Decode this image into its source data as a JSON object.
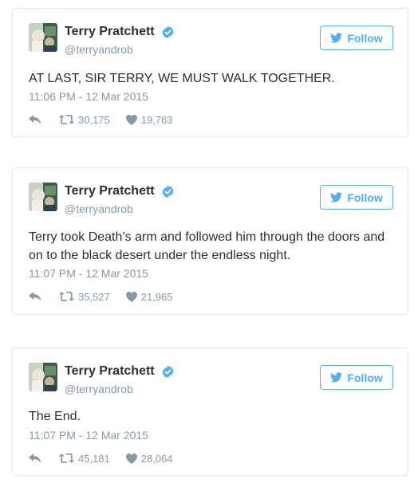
{
  "colors": {
    "accent": "#55acee",
    "text": "#292f33",
    "muted": "#8899a6",
    "border": "#e1e8ed"
  },
  "icons": {
    "reply": "reply-icon",
    "retweet": "retweet-icon",
    "like": "heart-icon",
    "verified": "verified-badge-icon",
    "twitter": "twitter-bird-icon"
  },
  "tweets": [
    {
      "author_name": "Terry Pratchett",
      "handle": "@terryandrob",
      "follow_label": "Follow",
      "text": "AT LAST, SIR TERRY, WE MUST WALK TOGETHER.",
      "timestamp": "11:06 PM - 12 Mar 2015",
      "retweets": "30,175",
      "likes": "19,763"
    },
    {
      "author_name": "Terry Pratchett",
      "handle": "@terryandrob",
      "follow_label": "Follow",
      "text": "Terry took Death’s arm and followed him through the doors and on to the black desert under the endless night.",
      "timestamp": "11:07 PM - 12 Mar 2015",
      "retweets": "35,527",
      "likes": "21,965"
    },
    {
      "author_name": "Terry Pratchett",
      "handle": "@terryandrob",
      "follow_label": "Follow",
      "text": "The End.",
      "timestamp": "11:07 PM - 12 Mar 2015",
      "retweets": "45,181",
      "likes": "28,064"
    }
  ]
}
